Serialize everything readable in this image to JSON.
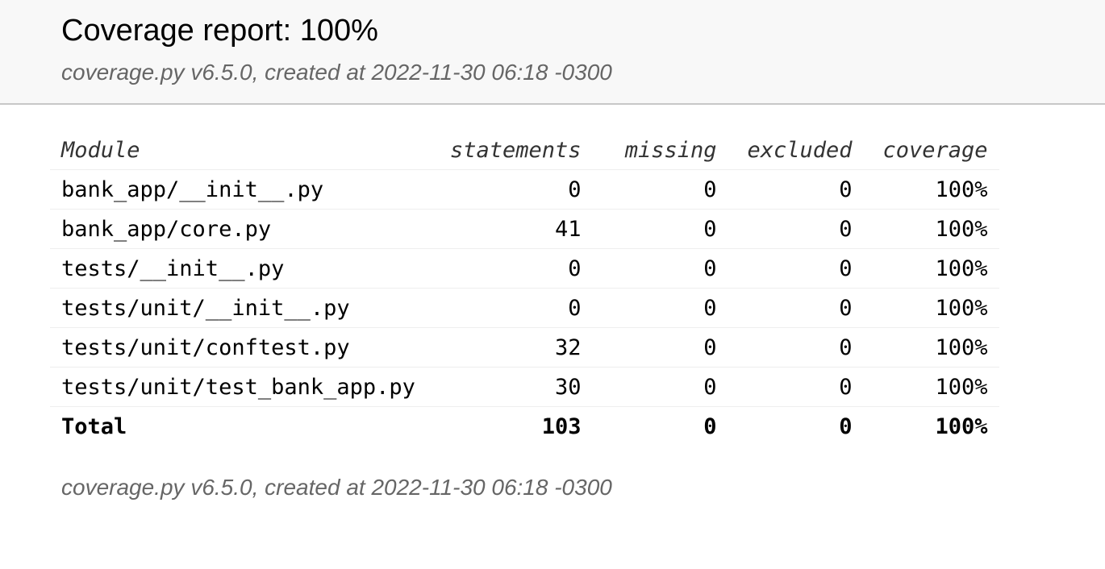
{
  "header": {
    "title": "Coverage report: 100%",
    "meta": "coverage.py v6.5.0, created at 2022-11-30 06:18 -0300"
  },
  "table": {
    "columns": [
      "Module",
      "statements",
      "missing",
      "excluded",
      "coverage"
    ],
    "rows": [
      {
        "module": "bank_app/__init__.py",
        "statements": "0",
        "missing": "0",
        "excluded": "0",
        "coverage": "100%"
      },
      {
        "module": "bank_app/core.py",
        "statements": "41",
        "missing": "0",
        "excluded": "0",
        "coverage": "100%"
      },
      {
        "module": "tests/__init__.py",
        "statements": "0",
        "missing": "0",
        "excluded": "0",
        "coverage": "100%"
      },
      {
        "module": "tests/unit/__init__.py",
        "statements": "0",
        "missing": "0",
        "excluded": "0",
        "coverage": "100%"
      },
      {
        "module": "tests/unit/conftest.py",
        "statements": "32",
        "missing": "0",
        "excluded": "0",
        "coverage": "100%"
      },
      {
        "module": "tests/unit/test_bank_app.py",
        "statements": "30",
        "missing": "0",
        "excluded": "0",
        "coverage": "100%"
      }
    ],
    "total": {
      "label": "Total",
      "statements": "103",
      "missing": "0",
      "excluded": "0",
      "coverage": "100%"
    }
  },
  "footer": {
    "meta": "coverage.py v6.5.0, created at 2022-11-30 06:18 -0300"
  }
}
